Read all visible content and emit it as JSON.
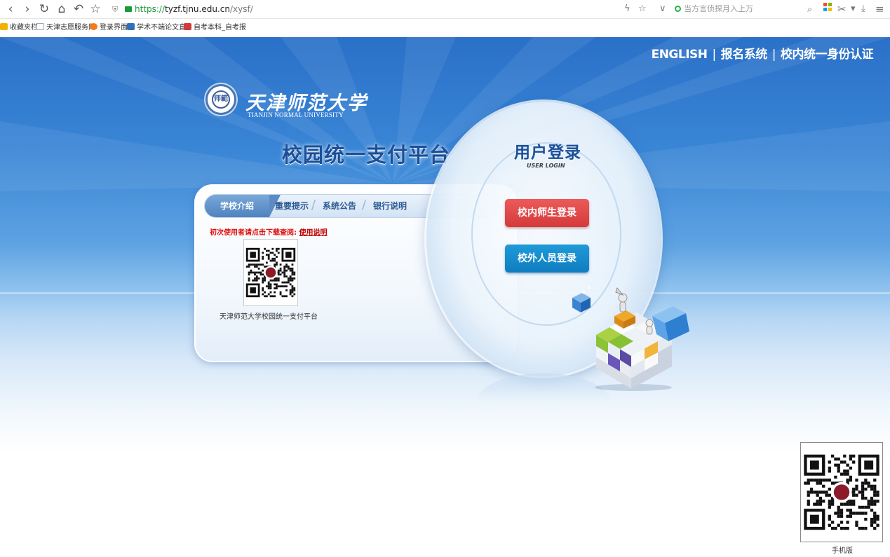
{
  "browser": {
    "url_scheme": "https://",
    "url_host": "tyzf.tjnu.edu.cn",
    "url_path": "/xysf/",
    "search_placeholder": "当方言侦探月入上万",
    "bookmarks": [
      {
        "label": "收藏夹栏",
        "color": "#f0b400"
      },
      {
        "label": "天津志愿服务网",
        "color": "#9aa5b5"
      },
      {
        "label": "登录界面",
        "color": "#f07d1a"
      },
      {
        "label": "学术不端论文直",
        "color": "#2f6fba"
      },
      {
        "label": "自考本科_自考报",
        "color": "#d23a3a"
      }
    ]
  },
  "header": {
    "links": [
      {
        "label": "ENGLISH"
      },
      {
        "label": "报名系统"
      },
      {
        "label": "校内统一身份认证"
      }
    ],
    "separator": "|"
  },
  "logo": {
    "seal_text": "师範",
    "name_cn": "天津师范大学",
    "name_en": "TIANJIN NORMAL UNIVERSITY"
  },
  "platform_title": "校园统一支付平台",
  "info_panel": {
    "tabs": [
      {
        "label": "学校介绍",
        "active": true
      },
      {
        "label": "重要提示",
        "active": false
      },
      {
        "label": "系统公告",
        "active": false
      },
      {
        "label": "银行说明",
        "active": false
      }
    ],
    "tab_separator": "/",
    "notice_text": "初次使用者请点击下载查阅:",
    "notice_link": "使用说明",
    "qr_caption": "天津师范大学校园统一支付平台"
  },
  "login": {
    "title": "用户登录",
    "subtitle": "USER LOGIN",
    "internal_button": "校内师生登录",
    "external_button": "校外人员登录"
  },
  "mobile_qr": {
    "caption": "手机版"
  },
  "colors": {
    "brand_blue": "#1b4f98",
    "login_red": "#d43a3a",
    "login_blue": "#0f7dc0",
    "url_green": "#1a9b3a"
  }
}
